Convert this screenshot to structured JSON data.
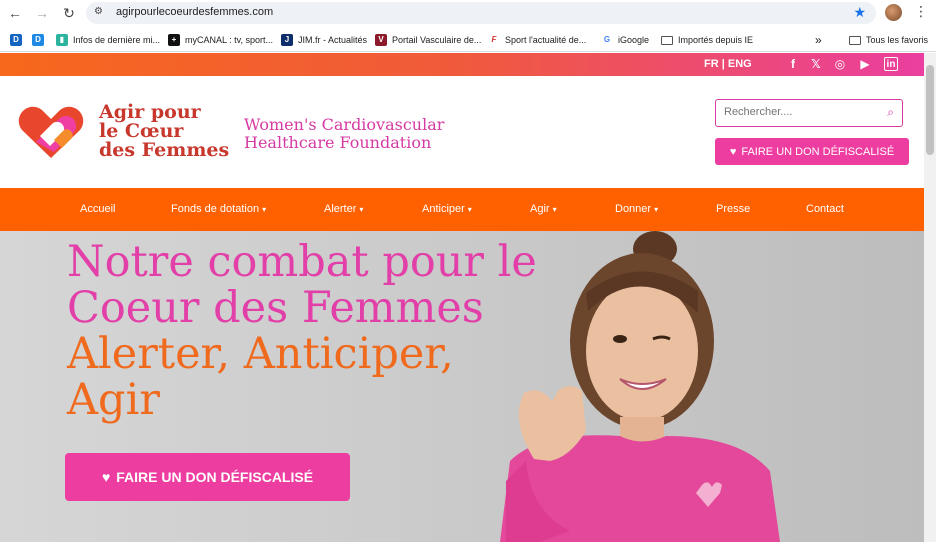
{
  "browser": {
    "url": "agirpourlecoeurdesfemmes.com",
    "bookmarks": [
      {
        "label": "",
        "icon": "D"
      },
      {
        "label": "",
        "icon": "D"
      },
      {
        "label": "Infos de dernière mi...",
        "icon": "▮"
      },
      {
        "label": "myCANAL : tv, sport...",
        "icon": "+"
      },
      {
        "label": "JIM.fr - Actualités",
        "icon": "J"
      },
      {
        "label": "Portail Vasculaire de...",
        "icon": "V"
      },
      {
        "label": "Sport  l'actualité de...",
        "icon": "F"
      },
      {
        "label": "iGoogle",
        "icon": "G"
      },
      {
        "label": "Importés depuis IE",
        "icon": "folder"
      }
    ],
    "more_bookmarks": "»",
    "all_bookmarks": "Tous les favoris"
  },
  "topbar": {
    "lang": "FR | ENG",
    "social": [
      "f",
      "𝕏",
      "◎",
      "▶",
      "in"
    ]
  },
  "header": {
    "logo_lines": [
      "Agir pour",
      "le Cœur",
      "des Femmes"
    ],
    "tagline_lines": [
      "Women's Cardiovascular",
      "Healthcare Foundation"
    ],
    "search_placeholder": "Rechercher....",
    "donate_label": "FAIRE UN DON DÉFISCALISÉ"
  },
  "nav": {
    "items": [
      {
        "label": "Accueil",
        "dropdown": false
      },
      {
        "label": "Fonds de dotation",
        "dropdown": true
      },
      {
        "label": "Alerter",
        "dropdown": true
      },
      {
        "label": "Anticiper",
        "dropdown": true
      },
      {
        "label": "Agir",
        "dropdown": true
      },
      {
        "label": "Donner",
        "dropdown": true
      },
      {
        "label": "Presse",
        "dropdown": false
      },
      {
        "label": "Contact",
        "dropdown": false
      }
    ]
  },
  "hero": {
    "line1": "Notre combat pour le",
    "line2": "Coeur des Femmes",
    "line3": "Alerter, Anticiper,",
    "line4": "Agir",
    "donate_label": "FAIRE UN DON DÉFISCALISÉ"
  },
  "colors": {
    "orange": "#ff6000",
    "pink": "#ed3da0",
    "logo_red": "#c7372c"
  }
}
